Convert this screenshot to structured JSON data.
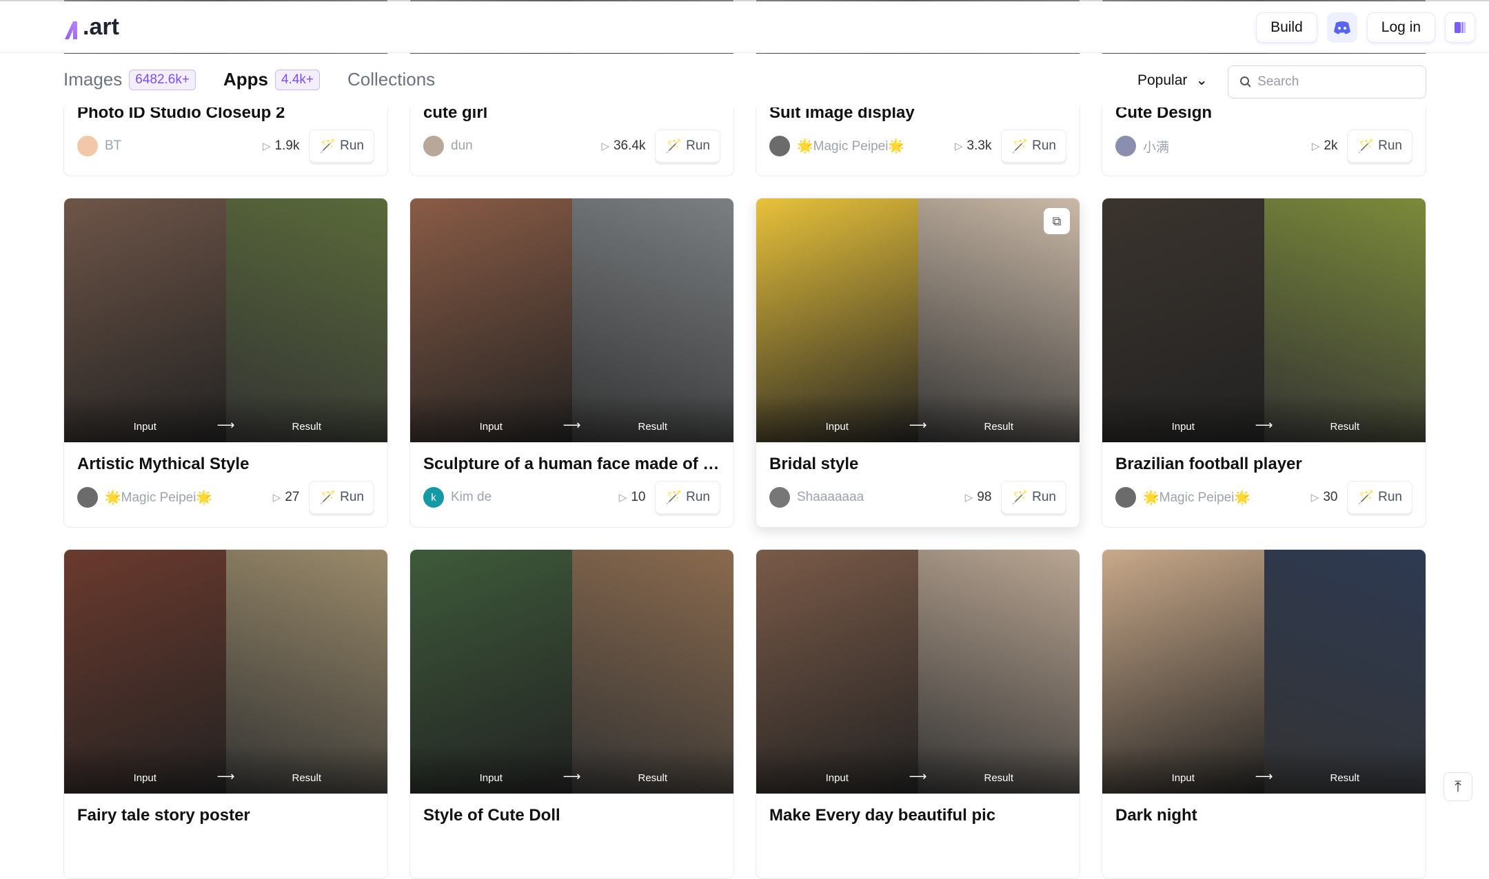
{
  "header": {
    "logo": ".art",
    "build": "Build",
    "login": "Log in",
    "icons": [
      "discord-icon",
      "library-icon"
    ]
  },
  "nav": {
    "tabs": [
      {
        "label": "Images",
        "badge": "6482.6k+"
      },
      {
        "label": "Apps",
        "badge": "4.4k+",
        "active": true
      },
      {
        "label": "Collections"
      }
    ],
    "sort": "Popular",
    "search_placeholder": "Search"
  },
  "accent": "#7c4dff",
  "cards": [
    {
      "title": "Photo ID Studio Closeup 2",
      "author": "BT",
      "runs": "1.9k",
      "run": "Run",
      "avatar": "#f2c9a8",
      "c1": "#ddd",
      "c2": "#ccc"
    },
    {
      "title": "cute girl",
      "author": "dun",
      "runs": "36.4k",
      "run": "Run",
      "avatar": "#b9a89a",
      "c1": "#ddd",
      "c2": "#ccc"
    },
    {
      "title": "Suit image display",
      "author": "🌟Magic Peipei🌟",
      "runs": "3.3k",
      "run": "Run",
      "avatar": "#6b6b6b",
      "c1": "#ddd",
      "c2": "#ccc"
    },
    {
      "title": "Cute Design",
      "author": "小满",
      "runs": "2k",
      "run": "Run",
      "avatar": "#8a8fb0",
      "c1": "#ddd",
      "c2": "#ccc"
    },
    {
      "title": "Artistic Mythical Style",
      "author": "🌟Magic Peipei🌟",
      "runs": "27",
      "run": "Run",
      "avatar": "#6b6b6b",
      "c1": "#6e5548",
      "c2": "#5a6a3a",
      "input": "Input",
      "result": "Result"
    },
    {
      "title": "Sculpture of a human face made of c...",
      "author": "Kim de",
      "runs": "10",
      "run": "Run",
      "avatar": "#1699a6",
      "avatar_letter": "k",
      "c1": "#8a5c46",
      "c2": "#7b7f82",
      "input": "Input",
      "result": "Result"
    },
    {
      "title": "Bridal style",
      "author": "Shaaaaaaa",
      "runs": "98",
      "run": "Run",
      "avatar": "#777",
      "c1": "#e8c23a",
      "c2": "#c9b8a6",
      "input": "Input",
      "result": "Result",
      "hover": true
    },
    {
      "title": "Brazilian football player",
      "author": "🌟Magic Peipei🌟",
      "runs": "30",
      "run": "Run",
      "avatar": "#6b6b6b",
      "c1": "#3b342e",
      "c2": "#7b8a3a",
      "input": "Input",
      "result": "Result"
    },
    {
      "title": "Fairy tale story poster",
      "author": "",
      "runs": "",
      "run": "",
      "c1": "#6b3a2e",
      "c2": "#9a8a6a",
      "input": "Input",
      "result": "Result"
    },
    {
      "title": "Style of Cute Doll",
      "author": "",
      "runs": "",
      "run": "",
      "c1": "#3e5a3a",
      "c2": "#8a6a4e",
      "input": "Input",
      "result": "Result"
    },
    {
      "title": "Make Every day beautiful pic",
      "author": "",
      "runs": "",
      "run": "",
      "c1": "#7a5a48",
      "c2": "#b9a592",
      "input": "Input",
      "result": "Result"
    },
    {
      "title": "Dark night",
      "author": "",
      "runs": "",
      "run": "",
      "c1": "#c9a98a",
      "c2": "#2e3a52",
      "input": "Input",
      "result": "Result"
    }
  ]
}
